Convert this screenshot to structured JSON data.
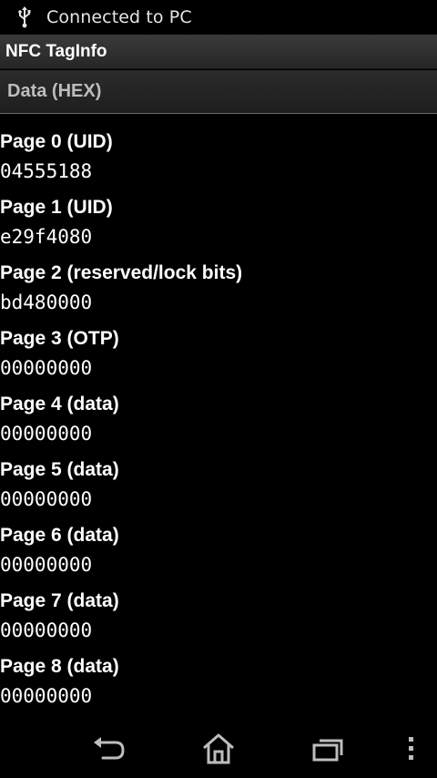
{
  "status_bar": {
    "icon": "usb-icon",
    "text": "Connected to PC"
  },
  "app": {
    "title": "NFC TagInfo"
  },
  "section": {
    "title": "Data (HEX)"
  },
  "pages": [
    {
      "label": "Page 0 (UID)",
      "value": "04555188"
    },
    {
      "label": "Page 1 (UID)",
      "value": "e29f4080"
    },
    {
      "label": "Page 2 (reserved/lock bits)",
      "value": "bd480000"
    },
    {
      "label": "Page 3 (OTP)",
      "value": "00000000"
    },
    {
      "label": "Page 4 (data)",
      "value": "00000000"
    },
    {
      "label": "Page 5 (data)",
      "value": "00000000"
    },
    {
      "label": "Page 6 (data)",
      "value": "00000000"
    },
    {
      "label": "Page 7 (data)",
      "value": "00000000"
    },
    {
      "label": "Page 8 (data)",
      "value": "00000000"
    }
  ],
  "nav_bar": {
    "icons": [
      "back-icon",
      "home-icon",
      "recent-apps-icon",
      "overflow-menu-icon"
    ]
  },
  "colors": {
    "background": "#000000",
    "text": "#ffffff",
    "section_text": "#bdbdbd"
  }
}
